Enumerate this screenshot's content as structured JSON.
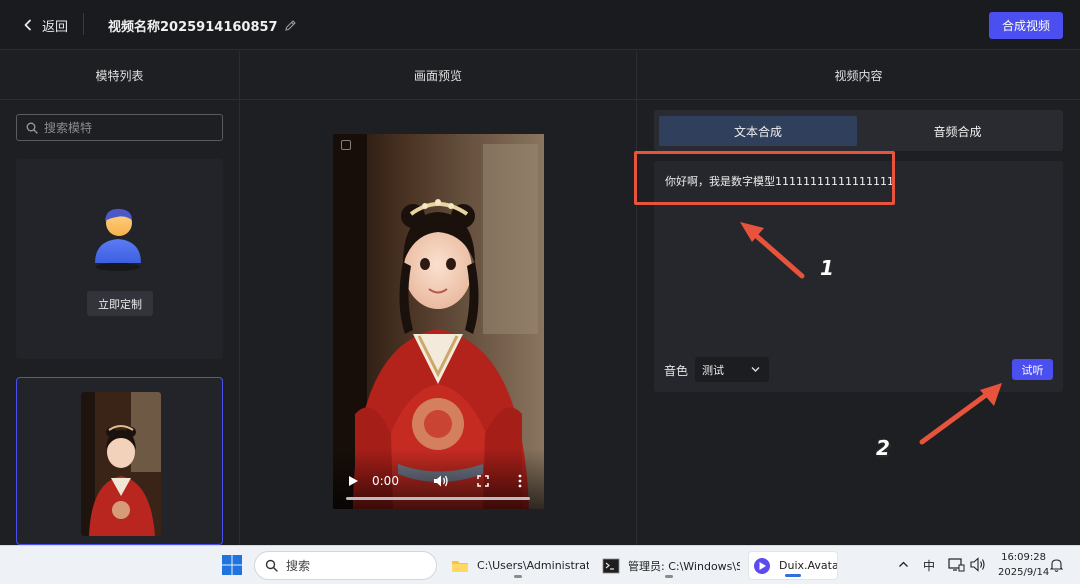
{
  "header": {
    "back_label": "返回",
    "video_title": "视频名称2025914160857",
    "compose_label": "合成视频"
  },
  "columns": {
    "models": "模特列表",
    "preview": "画面预览",
    "content": "视频内容"
  },
  "sidebar": {
    "search_placeholder": "搜索模特",
    "custom_label": "立即定制"
  },
  "player": {
    "time": "0:00"
  },
  "content": {
    "tabs": [
      "文本合成",
      "音频合成"
    ],
    "text": "你好啊，我是数字模型11111111111111111",
    "voice_label": "音色",
    "voice_value": "测试",
    "listen_label": "试听"
  },
  "annotations": {
    "step1": "1",
    "step2": "2",
    "color": "#e8533c"
  },
  "taskbar": {
    "search_label": "搜索",
    "apps": [
      {
        "label": "C:\\Users\\Administrator\\"
      },
      {
        "label": "管理员: C:\\Windows\\Sys"
      },
      {
        "label": "Duix.Avatar"
      }
    ],
    "ime": "中",
    "time": "16:09:28",
    "date": "2025/9/14"
  },
  "colors": {
    "accent": "#4b4ff0",
    "active_tab": "#2f3f5c",
    "background": "#1e1f23"
  }
}
